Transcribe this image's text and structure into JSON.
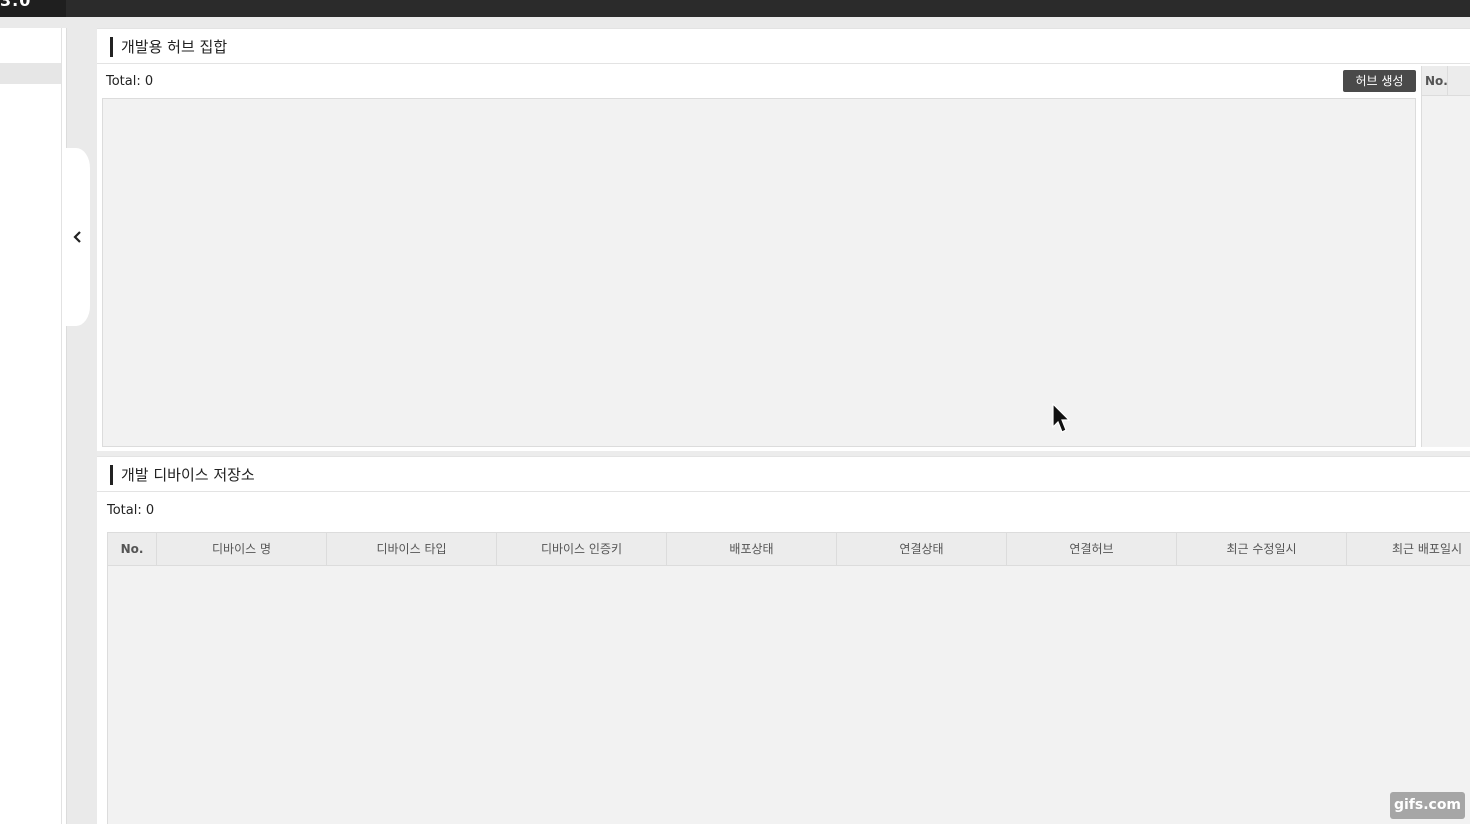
{
  "topbar": {
    "logo_fragment": "3.0"
  },
  "hub_panel": {
    "title": "개발용 허브 집합",
    "total": "Total: 0",
    "create_button": "허브 생성",
    "side_header": "No."
  },
  "device_panel": {
    "title": "개발 디바이스 저장소",
    "total": "Total: 0",
    "columns": [
      "No.",
      "디바이스 명",
      "디바이스 타입",
      "디바이스 인증키",
      "배포상태",
      "연결상태",
      "연결허브",
      "최근 수정일시",
      "최근 배포일시"
    ]
  },
  "watermark": "gifs.com",
  "icons": {
    "collapse": "chevron-left-icon",
    "cursor": "mouse-pointer-icon"
  }
}
